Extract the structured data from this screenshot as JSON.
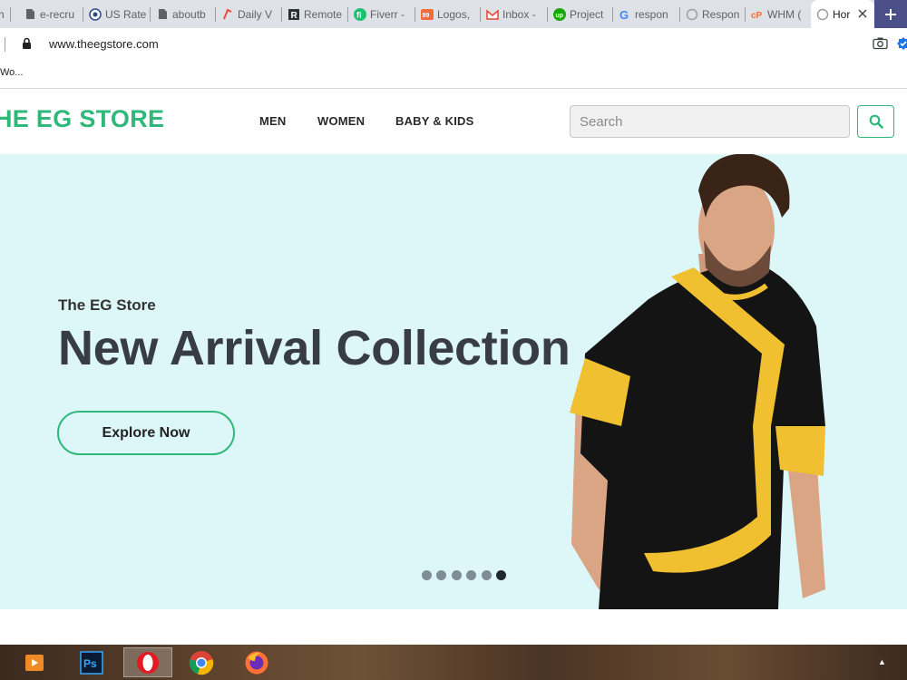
{
  "browser": {
    "tabs": [
      {
        "title": "h",
        "icon": "page-icon"
      },
      {
        "title": "e-recru",
        "icon": "document-icon"
      },
      {
        "title": "US Rate",
        "icon": "us-seal-icon"
      },
      {
        "title": "aboutb",
        "icon": "document-icon"
      },
      {
        "title": "Daily V",
        "icon": "daily-icon"
      },
      {
        "title": "Remote",
        "icon": "remote-r-icon"
      },
      {
        "title": "Fiverr -",
        "icon": "fiverr-icon"
      },
      {
        "title": "Logos,",
        "icon": "99designs-icon"
      },
      {
        "title": "Inbox -",
        "icon": "gmail-icon"
      },
      {
        "title": "Project",
        "icon": "upwork-icon"
      },
      {
        "title": "respon",
        "icon": "google-icon"
      },
      {
        "title": "Respon",
        "icon": "loading-icon"
      },
      {
        "title": "WHM (",
        "icon": "cpanel-icon"
      },
      {
        "title": "Hor",
        "icon": "loading-icon"
      }
    ],
    "url": "www.theegstore.com",
    "bookmark": "Wo..."
  },
  "site": {
    "logo": "HE EG STORE",
    "nav": [
      "MEN",
      "WOMEN",
      "BABY & KIDS"
    ],
    "search_placeholder": "Search"
  },
  "hero": {
    "eyebrow": "The EG Store",
    "title": "New Arrival Collection",
    "cta": "Explore Now",
    "slides_total": 6,
    "slide_active": 6
  },
  "taskbar": {
    "apps": [
      "media-player-icon",
      "photoshop-icon",
      "opera-icon",
      "chrome-icon",
      "firefox-icon"
    ],
    "photoshop_label": "Ps"
  },
  "colors": {
    "brand_green": "#2fb87a",
    "hero_bg": "#ddf7f9",
    "title_text": "#383c44",
    "tab_strip": "#dee1e6"
  }
}
